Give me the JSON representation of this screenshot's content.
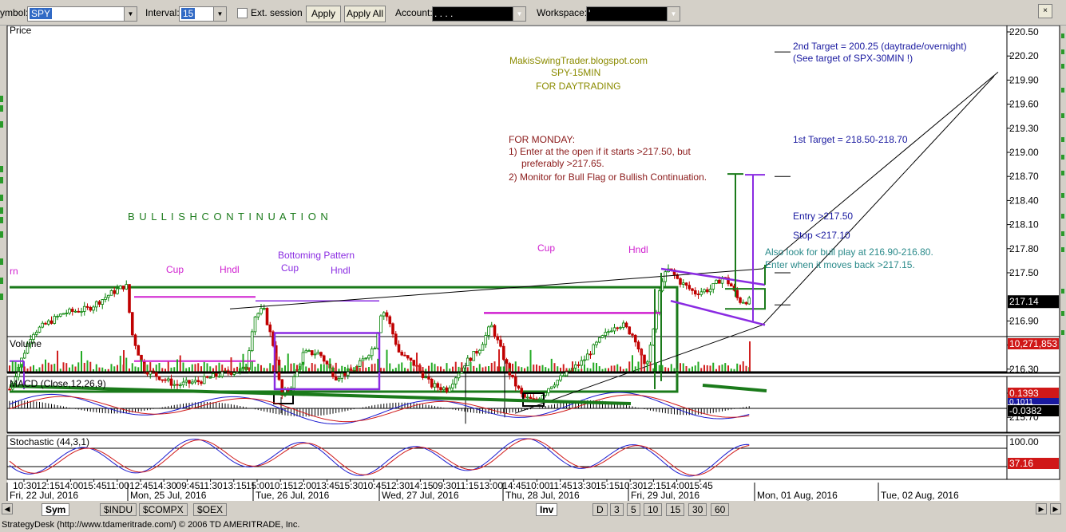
{
  "toolbar": {
    "symbol_label": "ymbol:",
    "symbol_value": "SPY",
    "interval_label": "Interval:",
    "interval_value": "15",
    "ext_session_label": "Ext. session",
    "apply_label": "Apply",
    "apply_all_label": "Apply All",
    "account_label": "Account:",
    "account_value": ". . . .",
    "workspace_label": "Workspace:",
    "workspace_value": "'"
  },
  "panels": {
    "price_title": "Price",
    "volume_title": "Volume",
    "macd_title": "MACD (Close,12,26,9)",
    "stoch_title": "Stochastic (44,3,1)"
  },
  "price_axis": [
    "220.50",
    "220.20",
    "219.90",
    "219.60",
    "219.30",
    "219.00",
    "218.70",
    "218.40",
    "218.10",
    "217.80",
    "217.50",
    "217.14",
    "216.90",
    "216.60",
    "216.30",
    "216.00",
    "215.70"
  ],
  "last_price": "217.14",
  "volume_value": "10,271,853",
  "macd_values": [
    "0.1393",
    "0.1011",
    "-0.0382"
  ],
  "stoch_values": [
    "100.00",
    "37.16"
  ],
  "time_labels": [
    "10:30",
    "12:15",
    "14:00",
    "15:45",
    "11:00",
    "12:45",
    "14:30",
    "09:45",
    "11:30",
    "13:15",
    "15:00",
    "10:15",
    "12:00",
    "13:45",
    "15:30",
    "10:45",
    "12:30",
    "14:15",
    "09:30",
    "11:15",
    "13:00",
    "14:45",
    "10:00",
    "11:45",
    "13:30",
    "15:15",
    "10:30",
    "12:15",
    "14:00",
    "15:45"
  ],
  "date_labels": [
    "Fri, 22 Jul, 2016",
    "Mon, 25 Jul, 2016",
    "Tue, 26 Jul, 2016",
    "Wed, 27 Jul, 2016",
    "Thu, 28 Jul, 2016",
    "Fri, 29 Jul, 2016",
    "Mon, 01 Aug, 2016",
    "Tue, 02 Aug, 2016"
  ],
  "annotations": {
    "blog_line1": "MakisSwingTrader.blogspot.com",
    "blog_line2": "SPY-15MIN",
    "blog_line3": "FOR DAYTRADING",
    "monday_title": "FOR MONDAY:",
    "monday_1": "1) Enter at the open if it starts >217.50, but",
    "monday_1b": "preferably >217.65.",
    "monday_2": "2) Monitor for  Bull Flag or Bullish Continuation.",
    "target2": "2nd Target = 200.25 (daytrade/overnight)",
    "target2b": "(See target of SPX-30MIN !)",
    "target1": "1st Target = 218.50-218.70",
    "entry": "Entry >217.50",
    "stop": "Stop <217.10",
    "bull_play": "Also look for bull play at 216.90-216.80.",
    "bull_play_b": "Enter when it moves back >217.15.",
    "bullish_cont": "B U L L I S H     C O N T I N U A T I O N",
    "cup1": "Cup",
    "hndl1": "Hndl",
    "bottoming": "Bottoming Pattern",
    "cup2": "Cup",
    "hndl2": "Hndl",
    "cup3": "Cup",
    "hndl3": "Hndl",
    "rn": "rn"
  },
  "tabs": {
    "sym": "Sym",
    "indu": "$INDU",
    "compx": "$COMPX",
    "oex": "$OEX",
    "inv": "Inv",
    "d": "D",
    "t3": "3",
    "t5": "5",
    "t10": "10",
    "t15": "15",
    "t30": "30",
    "t60": "60"
  },
  "status_text": "StrategyDesk (http://www.tdameritrade.com/) © 2006 TD AMERITRADE, Inc.",
  "colors": {
    "up": "#008000",
    "down": "#c00000",
    "green_box": "#1a7a1a",
    "purple": "#8a2be2",
    "magenta": "#d020d0",
    "annot_olive": "#8b8b00",
    "annot_red": "#8b1a1a",
    "annot_blue": "#1a1aa0",
    "annot_teal": "#2a8a8a"
  }
}
